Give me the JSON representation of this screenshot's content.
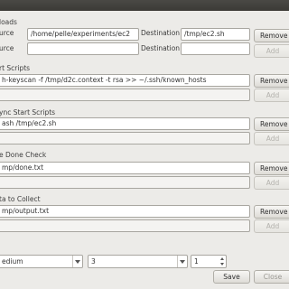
{
  "sections": {
    "uploads": {
      "label": "loads",
      "rows": [
        {
          "source_label": "urce",
          "source_value": "/home/pelle/experiments/ec2",
          "dest_label": "Destination",
          "dest_value": "/tmp/ec2.sh",
          "button": "Remove"
        },
        {
          "source_label": "urce",
          "source_value": "",
          "dest_label": "Destination",
          "dest_value": "",
          "button": "Add"
        }
      ]
    },
    "start_scripts": {
      "label": "rt Scripts",
      "value": "h-keyscan -f /tmp/d2c.context -t rsa >> ~/.ssh/known_hosts",
      "remove": "Remove",
      "add": "Add"
    },
    "async_scripts": {
      "label": "ync Start Scripts",
      "value": "ash /tmp/ec2.sh",
      "remove": "Remove",
      "add": "Add"
    },
    "done_check": {
      "label": "e Done Check",
      "value": "mp/done.txt",
      "remove": "Remove",
      "add": "Add"
    },
    "collect": {
      "label": "ta to Collect",
      "value": "mp/output.txt",
      "remove": "Remove",
      "add": "Add"
    }
  },
  "bottom": {
    "size_value": "edium",
    "count_value": "3",
    "spin_value": "1",
    "save": "Save",
    "cancel": "Close"
  }
}
